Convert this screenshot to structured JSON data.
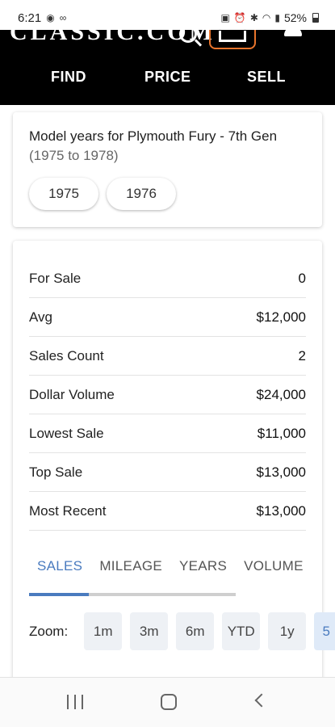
{
  "status_bar": {
    "time": "6:21",
    "battery_percent": "52%",
    "left_icons": [
      "messenger-icon",
      "voicemail-icon"
    ],
    "right_icons": [
      "nfc-icon",
      "alarm-icon",
      "bluetooth-icon",
      "wifi-icon",
      "signal-icon",
      "battery-icon"
    ]
  },
  "header": {
    "brand": "CLASSIC.COM",
    "nav": [
      "FIND",
      "PRICE",
      "SELL"
    ]
  },
  "years_card": {
    "title": "Model years for Plymouth Fury - 7th Gen",
    "range": "(1975 to 1978)",
    "years": [
      "1975",
      "1976"
    ]
  },
  "stats": [
    {
      "label": "For Sale",
      "value": "0"
    },
    {
      "label": "Avg",
      "value": "$12,000"
    },
    {
      "label": "Sales Count",
      "value": "2"
    },
    {
      "label": "Dollar Volume",
      "value": "$24,000"
    },
    {
      "label": "Lowest Sale",
      "value": "$11,000"
    },
    {
      "label": "Top Sale",
      "value": "$13,000"
    },
    {
      "label": "Most Recent",
      "value": "$13,000"
    }
  ],
  "tabs": {
    "items": [
      "SALES",
      "MILEAGE",
      "YEARS",
      "VOLUME"
    ],
    "active": "SALES"
  },
  "zoom": {
    "label": "Zoom:",
    "options": [
      "1m",
      "3m",
      "6m",
      "YTD",
      "1y",
      "5"
    ]
  },
  "colors": {
    "accent": "#4a7bbf",
    "header_bg": "#000000",
    "garage_outline": "#e8742c"
  }
}
